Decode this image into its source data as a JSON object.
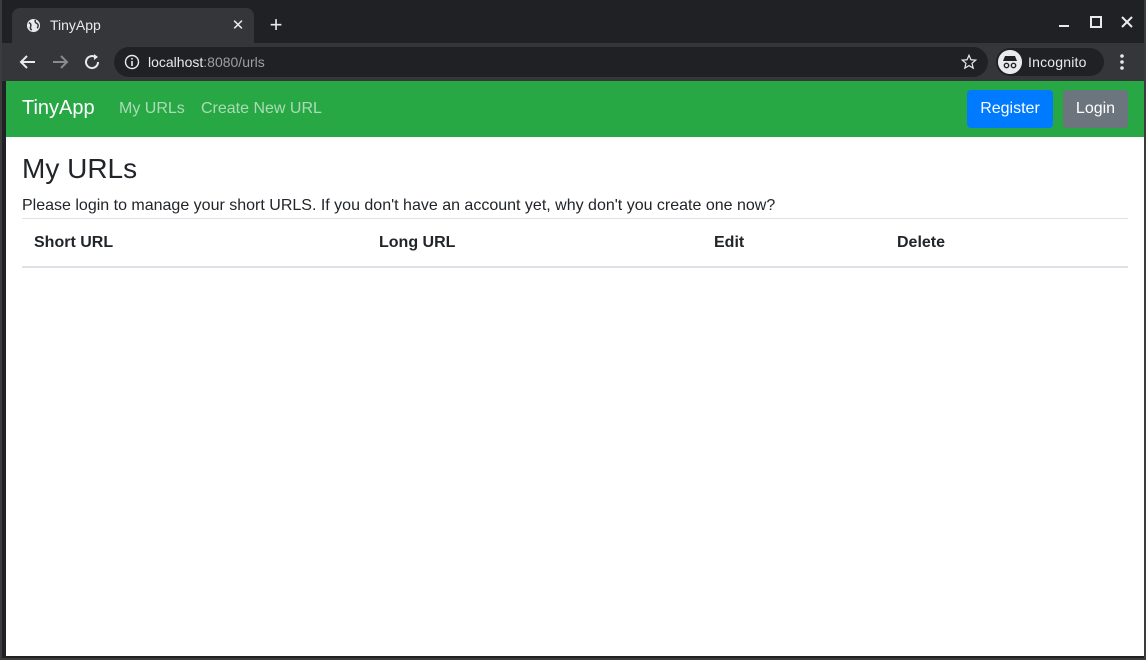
{
  "browser": {
    "tab_title": "TinyApp",
    "url_host": "localhost",
    "url_rest": ":8080/urls",
    "profile_label": "Incognito"
  },
  "navbar": {
    "brand": "TinyApp",
    "links": [
      "My URLs",
      "Create New URL"
    ],
    "register_label": "Register",
    "login_label": "Login",
    "colors": {
      "navbar": "#28a745",
      "register": "#007bff",
      "login": "#6c757d"
    }
  },
  "main": {
    "title": "My URLs",
    "notice": "Please login to manage your short URLS. If you don't have an account yet, why don't you create one now?",
    "table": {
      "headers": [
        "Short URL",
        "Long URL",
        "Edit",
        "Delete"
      ],
      "rows": []
    }
  }
}
